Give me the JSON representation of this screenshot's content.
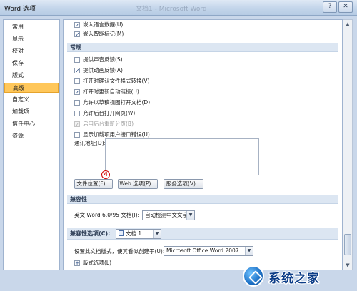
{
  "window": {
    "title": "Word 选项",
    "ghost_title": "文档1 - Microsoft Word"
  },
  "sidebar": {
    "items": [
      {
        "label": "常用"
      },
      {
        "label": "显示"
      },
      {
        "label": "校对"
      },
      {
        "label": "保存"
      },
      {
        "label": "版式"
      },
      {
        "label": "高级"
      },
      {
        "label": "自定义"
      },
      {
        "label": "加载项"
      },
      {
        "label": "信任中心"
      },
      {
        "label": "资源"
      }
    ],
    "selected": "高级"
  },
  "top_options": [
    {
      "label": "嵌入语言数据(U)",
      "checked": true
    },
    {
      "label": "嵌入智能标记(M)",
      "checked": true
    }
  ],
  "general_section": {
    "header": "常规",
    "options": [
      {
        "label": "提供声音反馈(S)",
        "checked": false,
        "disabled": false
      },
      {
        "label": "提供动画反馈(A)",
        "checked": true,
        "disabled": false
      },
      {
        "label": "打开时确认文件格式转换(V)",
        "checked": false,
        "disabled": false
      },
      {
        "label": "打开时更新自动链接(U)",
        "checked": true,
        "disabled": false
      },
      {
        "label": "允许以草稿视图打开文档(D)",
        "checked": false,
        "disabled": false
      },
      {
        "label": "允许后台打开网页(W)",
        "checked": false,
        "disabled": false
      },
      {
        "label": "启用后台重新分页(B)",
        "checked": true,
        "disabled": true
      },
      {
        "label": "显示加载项用户接口错误(U)",
        "checked": false,
        "disabled": false
      }
    ],
    "mailing_address_label": "通讯地址(D):",
    "buttons": {
      "file_locations": "文件位置(F)...",
      "web_options": "Web 选项(P)...",
      "service_options": "服务选项(V)..."
    },
    "step_marker": "4"
  },
  "compatibility": {
    "header": "兼容性",
    "row_label": "英文 Word 6.0/95 文档(I):",
    "row_value": "自动检测中文文字"
  },
  "compat_options": {
    "header_label": "兼容性选项(C):",
    "document_value": "文档 1",
    "layout_label": "设置此文档版式，使其看似创建于(U):",
    "layout_value": "Microsoft Office Word 2007",
    "expand_label": "版式选项(L)"
  },
  "watermark": {
    "text": "系统之家"
  },
  "colors": {
    "selected_bg": "#ffc75a",
    "section_bg": "#dce6f2",
    "marker": "#d10000",
    "watermark_text": "#0b3c87"
  }
}
